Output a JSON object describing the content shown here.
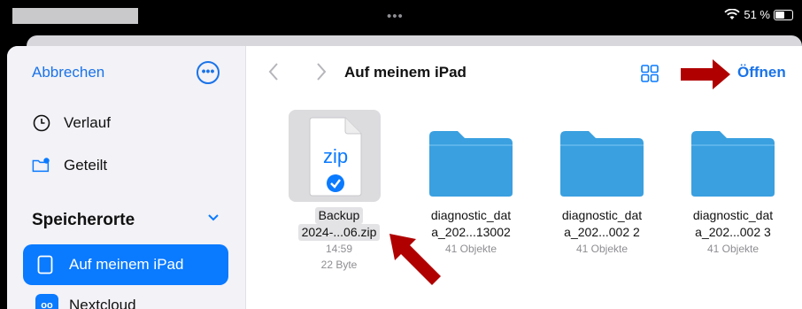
{
  "status": {
    "dots": "•••",
    "battery": "51 %",
    "battery_level": 0.51
  },
  "sidebar": {
    "cancel": "Abbrechen",
    "more_icon": "ellipsis-circle-icon",
    "recents": "Verlauf",
    "shared": "Geteilt",
    "locations_title": "Speicherorte",
    "locations": [
      {
        "label": "Auf meinem iPad",
        "active": true
      },
      {
        "label": "Nextcloud",
        "active": false
      }
    ]
  },
  "toolbar": {
    "title": "Auf meinem iPad",
    "open": "Öffnen",
    "view_icon": "grid-icon"
  },
  "files": [
    {
      "name_line1": "Backup",
      "name_line2": "2024-...06.zip",
      "meta1": "14:59",
      "meta2": "22 Byte",
      "badge": "zip",
      "type": "zip"
    },
    {
      "name_line1": "diagnostic_dat",
      "name_line2": "a_202...13002",
      "meta1": "41 Objekte",
      "type": "folder"
    },
    {
      "name_line1": "diagnostic_dat",
      "name_line2": "a_202...002 2",
      "meta1": "41 Objekte",
      "type": "folder"
    },
    {
      "name_line1": "diagnostic_dat",
      "name_line2": "a_202...002 3",
      "meta1": "41 Objekte",
      "type": "folder"
    }
  ],
  "colors": {
    "accent": "#0a7aff",
    "folder": "#3aa0e0",
    "annotation": "#b00000"
  }
}
